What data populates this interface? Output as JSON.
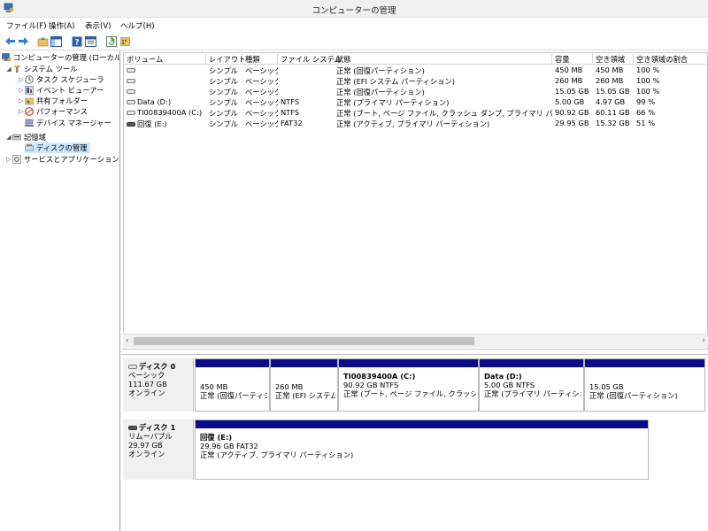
{
  "window": {
    "title": "コンピューターの管理",
    "icon": "computer-management-icon"
  },
  "menu": [
    {
      "label": "ファイル(F)"
    },
    {
      "label": "操作(A)"
    },
    {
      "label": "表示(V)"
    },
    {
      "label": "ヘルプ(H)"
    }
  ],
  "toolbar": [
    "back-arrow-icon",
    "forward-arrow-icon",
    "up-folder-icon",
    "show-hide-tree-icon",
    "help-icon",
    "properties-icon",
    "refresh-icon",
    "export-icon"
  ],
  "tree": [
    {
      "label": "コンピューターの管理 (ローカル)",
      "icon": "computer-management-icon",
      "expander": "",
      "indent": 0
    },
    {
      "label": "システム ツール",
      "icon": "tools-icon",
      "expander": "◢",
      "indent": 1
    },
    {
      "label": "タスク スケジューラ",
      "icon": "clock-icon",
      "expander": "▷",
      "indent": 2
    },
    {
      "label": "イベント ビューアー",
      "icon": "event-viewer-icon",
      "expander": "▷",
      "indent": 2
    },
    {
      "label": "共有フォルダー",
      "icon": "shared-folder-icon",
      "expander": "▷",
      "indent": 2
    },
    {
      "label": "パフォーマンス",
      "icon": "performance-icon",
      "expander": "▷",
      "indent": 2
    },
    {
      "label": "デバイス マネージャー",
      "icon": "device-manager-icon",
      "expander": "",
      "indent": 2
    },
    {
      "label": "記憶域",
      "icon": "storage-icon",
      "expander": "◢",
      "indent": 1
    },
    {
      "label": "ディスクの管理",
      "icon": "disk-management-icon",
      "expander": "",
      "indent": 2,
      "selected": true
    },
    {
      "label": "サービスとアプリケーション",
      "icon": "services-icon",
      "expander": "▷",
      "indent": 1
    }
  ],
  "volumes": {
    "headers": [
      "ボリューム",
      "レイアウト",
      "種類",
      "ファイル システム",
      "状態",
      "容量",
      "空き領域",
      "空き領域の割合"
    ],
    "rows": [
      {
        "volume": "",
        "layout": "シンプル",
        "type": "ベーシック",
        "fs": "",
        "status": "正常 (回復パーティション)",
        "capacity": "450 MB",
        "free": "450 MB",
        "pct": "100 %",
        "icon": "disk-icon"
      },
      {
        "volume": "",
        "layout": "シンプル",
        "type": "ベーシック",
        "fs": "",
        "status": "正常 (EFI システム パーティション)",
        "capacity": "260 MB",
        "free": "260 MB",
        "pct": "100 %",
        "icon": "disk-icon"
      },
      {
        "volume": "",
        "layout": "シンプル",
        "type": "ベーシック",
        "fs": "",
        "status": "正常 (回復パーティション)",
        "capacity": "15.05 GB",
        "free": "15.05 GB",
        "pct": "100 %",
        "icon": "disk-icon"
      },
      {
        "volume": "Data (D:)",
        "layout": "シンプル",
        "type": "ベーシック",
        "fs": "NTFS",
        "status": "正常 (プライマリ パーティション)",
        "capacity": "5.00 GB",
        "free": "4.97 GB",
        "pct": "99 %",
        "icon": "disk-icon"
      },
      {
        "volume": "TI00839400A (C:)",
        "layout": "シンプル",
        "type": "ベーシック",
        "fs": "NTFS",
        "status": "正常 (ブート, ページ ファイル, クラッシュ ダンプ, プライマリ パーティション)",
        "capacity": "90.92 GB",
        "free": "60.11 GB",
        "pct": "66 %",
        "icon": "disk-icon"
      },
      {
        "volume": "回復 (E:)",
        "layout": "シンプル",
        "type": "ベーシック",
        "fs": "FAT32",
        "status": "正常 (アクティブ, プライマリ パーティション)",
        "capacity": "29.95 GB",
        "free": "15.32 GB",
        "pct": "51 %",
        "icon": "removable-disk-icon"
      }
    ]
  },
  "disks": [
    {
      "name": "ディスク 0",
      "type": "ベーシック",
      "size": "111.67 GB",
      "state": "オンライン",
      "icon": "disk-icon",
      "partitions": [
        {
          "title": "",
          "size": "450 MB",
          "status": "正常 (回復パーティション)"
        },
        {
          "title": "",
          "size": "260 MB",
          "status": "正常 (EFI システム パーティション)"
        },
        {
          "title": "TI00839400A  (C:)",
          "size": "90.92 GB NTFS",
          "status": "正常 (ブート, ページ ファイル, クラッシュ ダンプ, プライマリ パーティション)"
        },
        {
          "title": "Data  (D:)",
          "size": "5.00 GB NTFS",
          "status": "正常 (プライマリ パーティション)"
        },
        {
          "title": "",
          "size": "15.05 GB",
          "status": "正常 (回復パーティション)"
        }
      ]
    },
    {
      "name": "ディスク 1",
      "type": "リムーバブル",
      "size": "29.97 GB",
      "state": "オンライン",
      "icon": "removable-disk-icon",
      "partitions": [
        {
          "title": "回復  (E:)",
          "size": "29.96 GB FAT32",
          "status": "正常 (アクティブ, プライマリ パーティション)"
        }
      ]
    }
  ],
  "colors": {
    "partition_bar": "#0b0b8a",
    "selection": "#cce8ff",
    "chrome": "#f0f0f0"
  }
}
